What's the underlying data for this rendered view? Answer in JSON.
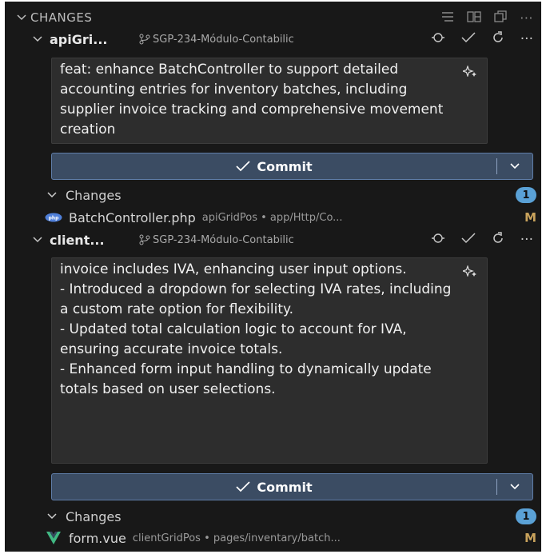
{
  "section": {
    "title": "CHANGES",
    "actions": [
      "list-tree-icon",
      "layout-icon",
      "open-window-icon",
      "more-icon"
    ]
  },
  "repos": [
    {
      "name": "apiGri...",
      "branch": "SGP-234-Módulo-Contabilic",
      "message": "feat: enhance BatchController to support detailed accounting entries for inventory batches, including supplier invoice tracking and comprehensive movement creation",
      "commit_label": "Commit",
      "changes_label": "Changes",
      "changes_count": "1",
      "file": {
        "name": "BatchController.php",
        "path": "apiGridPos • app/Http/Co...",
        "status": "M",
        "icon": "php-icon"
      }
    },
    {
      "name": "client...",
      "branch": "SGP-234-Módulo-Contabilic",
      "message": "invoice includes IVA, enhancing user input options.\n- Introduced a dropdown for selecting IVA rates, including a custom rate option for flexibility.\n- Updated total calculation logic to account for IVA, ensuring accurate invoice totals.\n- Enhanced form input handling to dynamically update totals based on user selections.",
      "commit_label": "Commit",
      "changes_label": "Changes",
      "changes_count": "1",
      "file": {
        "name": "form.vue",
        "path": "clientGridPos • pages/inventary/batch...",
        "status": "M",
        "icon": "vue-icon"
      }
    }
  ],
  "colors": {
    "panel_bg": "#181818",
    "commit_bg": "#3b4c63",
    "commit_border": "#5f7da8",
    "badge_bg": "#5aa1d6",
    "modified": "#c9a35c"
  }
}
